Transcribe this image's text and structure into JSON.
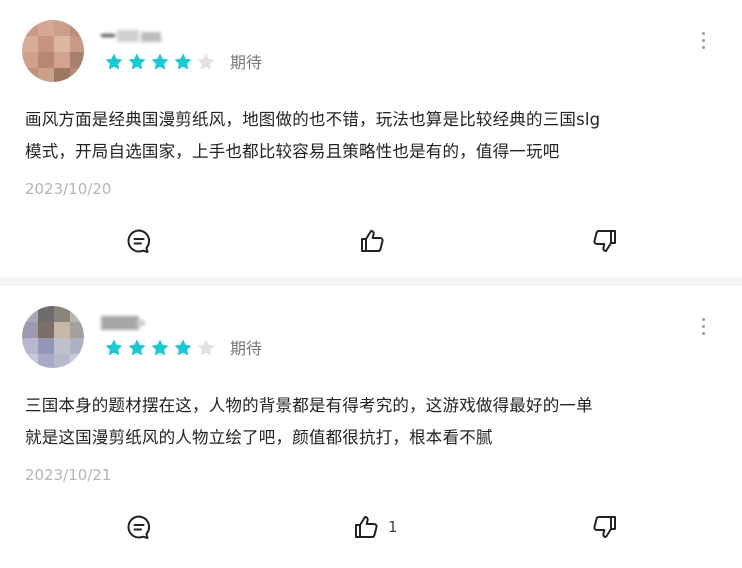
{
  "reviews": [
    {
      "status": "期待",
      "rating": 4,
      "max_rating": 5,
      "body_line1": "画风方面是经典国漫剪纸风，地图做的也不错，玩法也算是比较经典的三国slg",
      "body_line2": "模式，开局自选国家，上手也都比较容易且策略性也是有的，值得一玩吧",
      "date": "2023/10/20",
      "like_count": "",
      "icons": {
        "comment": "comment-icon",
        "like": "thumbs-up-icon",
        "dislike": "thumbs-down-icon",
        "more": "more-vertical-icon"
      }
    },
    {
      "status": "期待",
      "rating": 4,
      "max_rating": 5,
      "body_line1": "三国本身的题材摆在这，人物的背景都是有得考究的，这游戏做得最好的一单",
      "body_line2": "就是这国漫剪纸风的人物立绘了吧，颜值都很抗打，根本看不腻",
      "date": "2023/10/21",
      "like_count": "1",
      "icons": {
        "comment": "comment-icon",
        "like": "thumbs-up-icon",
        "dislike": "thumbs-down-icon",
        "more": "more-vertical-icon"
      }
    }
  ],
  "colors": {
    "star_filled": "#1ec8d3",
    "star_empty": "#e2e2e2",
    "separator": "#f4f4f6"
  }
}
